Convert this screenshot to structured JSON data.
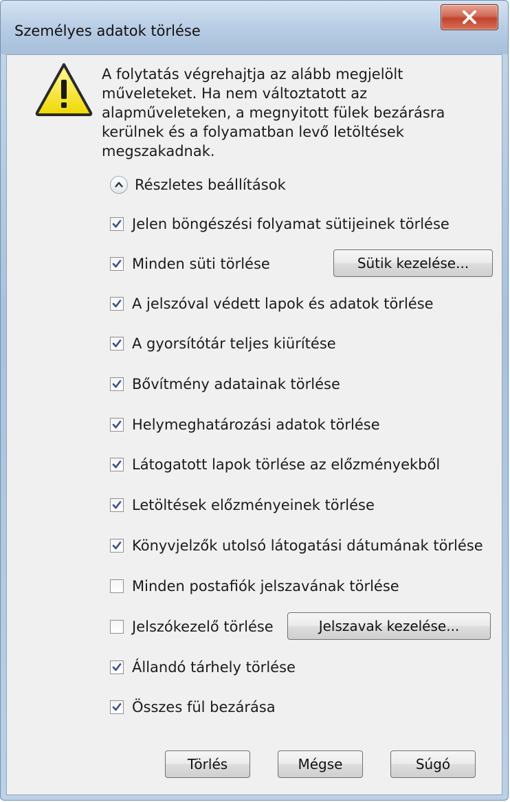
{
  "window": {
    "title": "Személyes adatok törlése"
  },
  "message": "A folytatás végrehajtja az alább megjelölt műveleteket. Ha nem változtatott az alapműveleteken, a megnyitott fülek bezárásra kerülnek és a folyamatban levő letöltések megszakadnak.",
  "details_label": "Részletes beállítások",
  "options": [
    {
      "label": "Jelen böngészési folyamat sütijeinek törlése",
      "checked": true
    },
    {
      "label": "Minden süti törlése",
      "checked": true,
      "button": "Sütik kezelése..."
    },
    {
      "label": "A jelszóval védett lapok és adatok törlése",
      "checked": true
    },
    {
      "label": "A gyorsítótár teljes kiürítése",
      "checked": true
    },
    {
      "label": "Bővítmény adatainak törlése",
      "checked": true
    },
    {
      "label": "Helymeghatározási adatok törlése",
      "checked": true
    },
    {
      "label": "Látogatott lapok törlése az előzményekből",
      "checked": true
    },
    {
      "label": "Letöltések előzményeinek törlése",
      "checked": true
    },
    {
      "label": "Könyvjelzők utolsó látogatási dátumának törlése",
      "checked": true
    },
    {
      "label": "Minden postafiók jelszavának törlése",
      "checked": false
    },
    {
      "label": "Jelszókezelő törlése",
      "checked": false,
      "button": "Jelszavak kezelése..."
    },
    {
      "label": "Állandó tárhely törlése",
      "checked": true
    },
    {
      "label": "Összes fül bezárása",
      "checked": true
    }
  ],
  "buttons": {
    "delete": "Törlés",
    "cancel": "Mégse",
    "help": "Súgó"
  }
}
